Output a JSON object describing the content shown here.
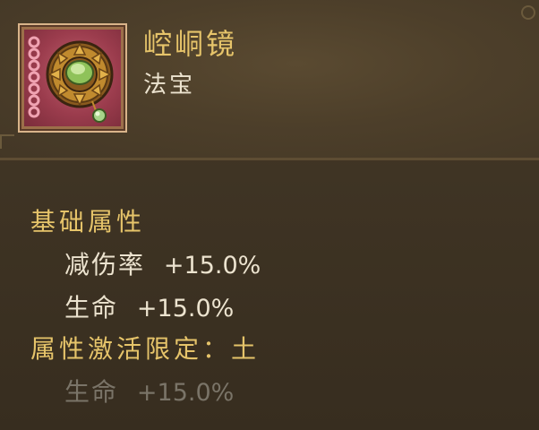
{
  "item": {
    "name": "崆峒镜",
    "type": "法宝",
    "icon": "bronze-mirror-jade-icon"
  },
  "basic": {
    "title": "基础属性",
    "attrs": [
      {
        "name": "减伤率",
        "value": "+15.0%"
      },
      {
        "name": "生命",
        "value": "+15.0%"
      }
    ]
  },
  "activation": {
    "title": "属性激活限定：土",
    "attrs": [
      {
        "name": "生命",
        "value": "+15.0%"
      }
    ]
  },
  "colors": {
    "gold": "#e6c46a",
    "text": "#ece3cf",
    "inactive": "#7a7468",
    "background": "#3b3122"
  }
}
